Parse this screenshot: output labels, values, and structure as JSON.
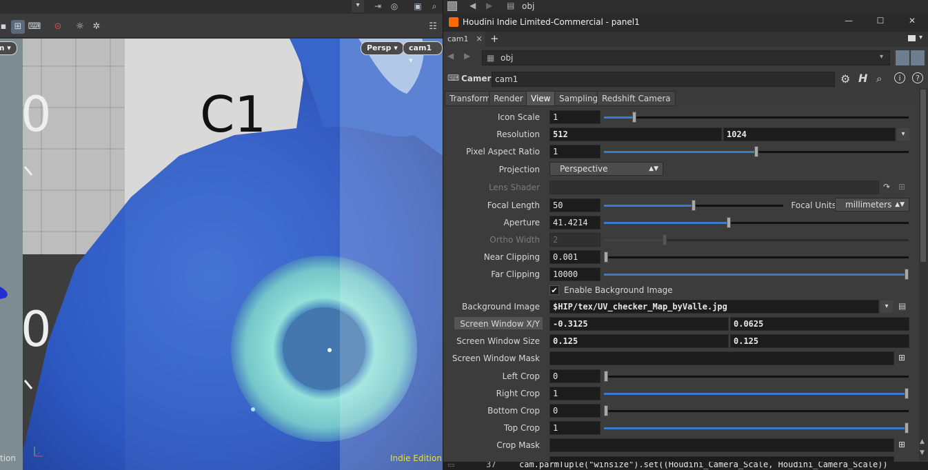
{
  "viewport": {
    "scene_text": "C1",
    "axis_digits": [
      "0",
      "0"
    ],
    "persp_label": "Persp",
    "camera_label": "cam1",
    "left_pill": "m",
    "watermark": "Indie Edition",
    "left_edge_text": "tion"
  },
  "topstrip": {
    "path_label": "obj"
  },
  "window": {
    "title": "Houdini Indie Limited-Commercial - panel1",
    "minimize": "—",
    "maximize": "☐",
    "close": "✕"
  },
  "tabstrip": {
    "tab_label": "cam1",
    "close_tab": "×",
    "add_tab": "+"
  },
  "pathbar": {
    "path": "obj"
  },
  "node": {
    "type": "Camera",
    "name": "cam1"
  },
  "param_tabs": [
    "Transform",
    "Render",
    "View",
    "Sampling",
    "Redshift Camera"
  ],
  "params": {
    "icon_scale": {
      "label": "Icon Scale",
      "value": "1"
    },
    "resolution": {
      "label": "Resolution",
      "x": "512",
      "y": "1024"
    },
    "pixel_aspect": {
      "label": "Pixel Aspect Ratio",
      "value": "1"
    },
    "projection": {
      "label": "Projection",
      "value": "Perspective"
    },
    "lens_shader": {
      "label": "Lens Shader",
      "value": ""
    },
    "focal_length": {
      "label": "Focal Length",
      "value": "50"
    },
    "focal_units": {
      "label": "Focal Units",
      "value": "millimeters"
    },
    "aperture": {
      "label": "Aperture",
      "value": "41.4214"
    },
    "ortho_width": {
      "label": "Ortho Width",
      "value": "2"
    },
    "near_clipping": {
      "label": "Near Clipping",
      "value": "0.001"
    },
    "far_clipping": {
      "label": "Far Clipping",
      "value": "10000"
    },
    "enable_bg": {
      "label": "Enable Background Image",
      "checked": "✔"
    },
    "bg_image": {
      "label": "Background Image",
      "value": "$HIP/tex/UV_checker_Map_byValle.jpg"
    },
    "screen_window_xy": {
      "label": "Screen Window X/Y",
      "x": "-0.3125",
      "y": "0.0625"
    },
    "screen_window_size": {
      "label": "Screen Window Size",
      "x": "0.125",
      "y": "0.125"
    },
    "screen_window_mask": {
      "label": "Screen Window Mask",
      "value": ""
    },
    "left_crop": {
      "label": "Left Crop",
      "value": "0"
    },
    "right_crop": {
      "label": "Right Crop",
      "value": "1"
    },
    "bottom_crop": {
      "label": "Bottom Crop",
      "value": "0"
    },
    "top_crop": {
      "label": "Top Crop",
      "value": "1"
    },
    "crop_mask": {
      "label": "Crop Mask",
      "value": ""
    }
  },
  "slider_levels": {
    "icon_scale": 0.1,
    "pixel_aspect": 0.5,
    "focal_length": 0.5,
    "aperture": 0.41,
    "ortho_width": 0.2,
    "near_clipping": 0.0,
    "far_clipping": 1.0,
    "left_crop": 0.0,
    "right_crop": 1.0,
    "bottom_crop": 0.0,
    "top_crop": 1.0
  },
  "python_line": {
    "line_no": "37",
    "code": "cam.parmTuple(\"winsize\").set((Houdini_Camera_Scale, Houdini_Camera_Scale))"
  },
  "colors": {
    "accent_blue": "#3b7bd1",
    "houdini_orange": "#ff6a00",
    "watermark": "#e8e040"
  }
}
